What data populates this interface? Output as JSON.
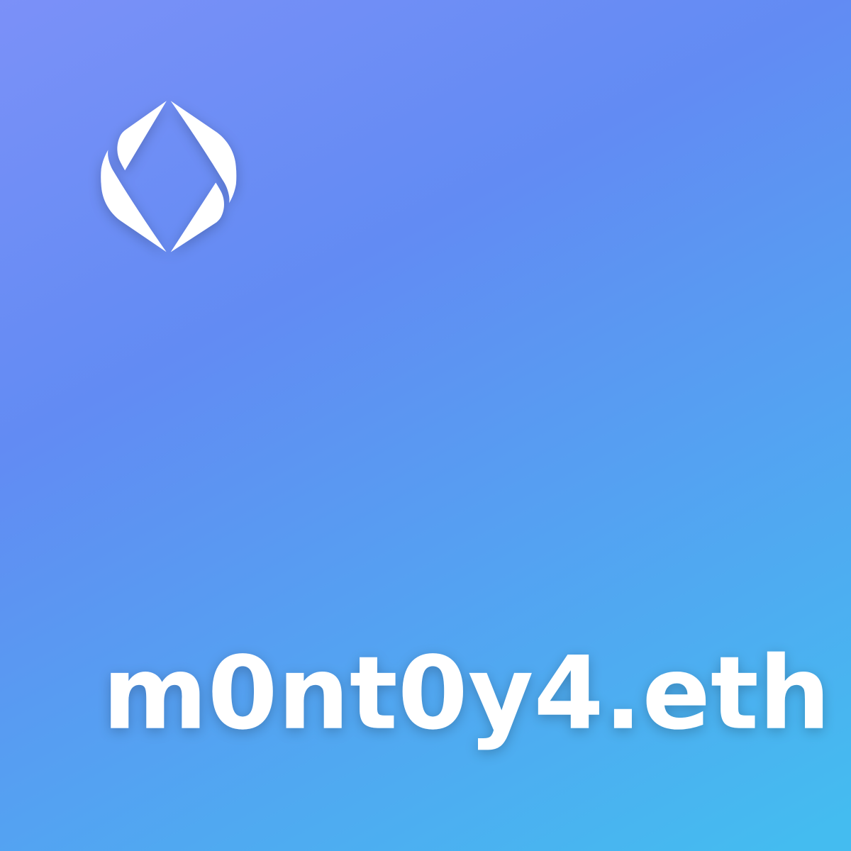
{
  "card": {
    "name": "m0nt0y4.eth",
    "logo": "ens-logo-icon",
    "colors": {
      "gradient_start": "#44BCF0",
      "gradient_mid": "#628BF3",
      "gradient_end": "#A099FF",
      "text": "#FFFFFF"
    }
  }
}
